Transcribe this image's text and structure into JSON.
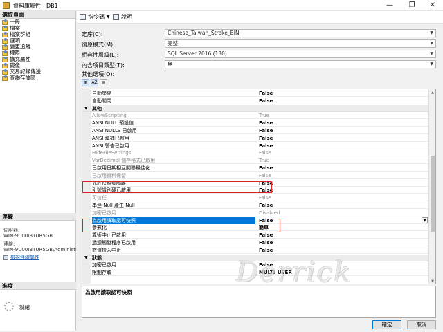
{
  "window": {
    "title": "資料庫屬性 - DB1",
    "minimize": "—",
    "maximize": "❐",
    "close": "✕"
  },
  "left": {
    "select_page_header": "選取頁面",
    "pages": [
      "一般",
      "檔案",
      "檔案群組",
      "選項",
      "變更追蹤",
      "權限",
      "擴充屬性",
      "鏡像",
      "交易記錄傳送",
      "查詢存放區"
    ],
    "connection_header": "連線",
    "server_label": "伺服器:",
    "server_value": "WIN-9U00IBTUR5GB",
    "conn_label": "連線:",
    "conn_value": "WIN-9U00IBTUR5GB\\Administrat",
    "view_conn_props": "檢視連線屬性",
    "progress_header": "進度",
    "progress_status": "就緒"
  },
  "toolbar": {
    "script_label": "指令碼",
    "help_label": "說明"
  },
  "form": {
    "collation_label": "定序(C):",
    "collation_value": "Chinese_Taiwan_Stroke_BIN",
    "recovery_label": "復原模式(M):",
    "recovery_value": "完整",
    "compat_label": "相容性層級(L):",
    "compat_value": "SQL Server 2016 (130)",
    "containment_label": "內含項目類型(T):",
    "containment_value": "無",
    "other_options_label": "其他選項(O):"
  },
  "grid_buttons": {
    "categorized": "⊞",
    "alphabetical": "AZ",
    "pages": "▤"
  },
  "properties": [
    {
      "kind": "row",
      "name": "自動壓縮",
      "value": "False",
      "style": "bold"
    },
    {
      "kind": "row",
      "name": "自動關閉",
      "value": "False",
      "style": "bold"
    },
    {
      "kind": "cat",
      "name": "其他",
      "toggle": "▼"
    },
    {
      "kind": "row",
      "name": "AllowScripting",
      "value": "True",
      "style": "dim"
    },
    {
      "kind": "row",
      "name": "ANSI NULL 預設值",
      "value": "False",
      "style": "bold"
    },
    {
      "kind": "row",
      "name": "ANSI NULLS 已啟用",
      "value": "False",
      "style": "bold"
    },
    {
      "kind": "row",
      "name": "ANSI 填補已啟用",
      "value": "False",
      "style": "bold"
    },
    {
      "kind": "row",
      "name": "ANSI 警告已啟用",
      "value": "False",
      "style": "bold"
    },
    {
      "kind": "row",
      "name": "HideFileSettings",
      "value": "False",
      "style": "dim"
    },
    {
      "kind": "row",
      "name": "VarDecimal 儲存格式已啟用",
      "value": "True",
      "style": "dim"
    },
    {
      "kind": "row",
      "name": "已啟用日期相互關聯最佳化",
      "value": "False",
      "style": "bold"
    },
    {
      "kind": "row",
      "name": "已啟用資料保留",
      "value": "False",
      "style": "dim"
    },
    {
      "kind": "row",
      "name": "允許快照集隔離",
      "value": "False",
      "style": "bold"
    },
    {
      "kind": "row",
      "name": "引號識別碼已啟用",
      "value": "False",
      "style": "bold"
    },
    {
      "kind": "row",
      "name": "可信任",
      "value": "False",
      "style": "dim"
    },
    {
      "kind": "row",
      "name": "串連 Null 產生 Null",
      "value": "False",
      "style": "bold"
    },
    {
      "kind": "row",
      "name": "加密已啟用",
      "value": "Disabled",
      "style": "dim"
    },
    {
      "kind": "row",
      "name": "為啟用讀取認可快照",
      "value": "False",
      "style": "sel"
    },
    {
      "kind": "row",
      "name": "參數化",
      "value": "簡單",
      "style": "bold"
    },
    {
      "kind": "row",
      "name": "算術中止已啟用",
      "value": "False",
      "style": "bold"
    },
    {
      "kind": "row",
      "name": "遞迴觸發程序已啟用",
      "value": "False",
      "style": "bold"
    },
    {
      "kind": "row",
      "name": "數值捨入中止",
      "value": "False",
      "style": "bold"
    },
    {
      "kind": "cat",
      "name": "狀態",
      "toggle": "▼"
    },
    {
      "kind": "row",
      "name": "加密已啟用",
      "value": "False",
      "style": "bold"
    },
    {
      "kind": "row",
      "name": "限制存取",
      "value": "MULTI_USER",
      "style": "bold"
    }
  ],
  "description": {
    "title": "為啟用讀取認可快照"
  },
  "watermark": "Derrick",
  "footer": {
    "ok": "確定",
    "cancel": "取消"
  },
  "colors": {
    "selection": "#0078d7",
    "highlight_box": "#e02020"
  }
}
